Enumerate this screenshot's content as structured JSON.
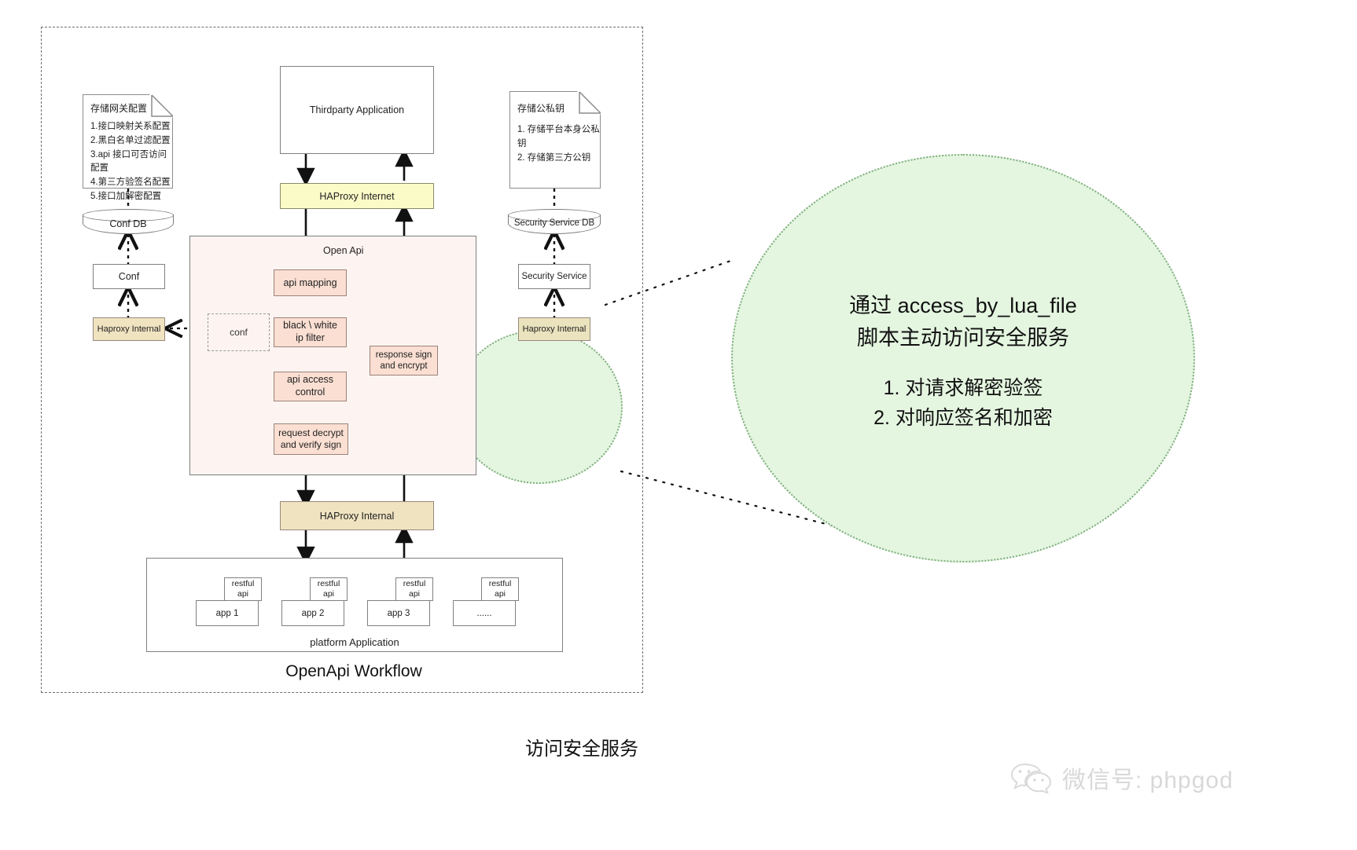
{
  "diagram": {
    "bottom_title": "访问安全服务",
    "workflow_title": "OpenApi Workflow",
    "region_label": "Open Api",
    "platform_label": "platform Application"
  },
  "notes": {
    "gateway_conf": {
      "title": "存储网关配置",
      "lines": [
        "1.接口映射关系配置",
        "2.黑白名单过滤配置",
        "3.api 接口可否访问配置",
        "4.第三方验签名配置",
        "5.接口加解密配置"
      ]
    },
    "keys": {
      "title": "存储公私钥",
      "lines": [
        "1. 存储平台本身公私钥",
        "2. 存储第三方公钥"
      ]
    }
  },
  "nodes": {
    "thirdparty_application": "Thirdparty Application",
    "haproxy_internet": "HAProxy Internet",
    "conf_db": "Conf DB",
    "conf": "Conf",
    "haproxy_internal_left": "Haproxy Internal",
    "security_service_db": "Security Service DB",
    "security_service": "Security Service",
    "haproxy_internal_right": "Haproxy Internal",
    "api_mapping": "api mapping",
    "black_white_ip_filter_l1": "black \\ white",
    "black_white_ip_filter_l2": "ip filter",
    "api_access_control_l1": "api access",
    "api_access_control_l2": "control",
    "request_decrypt_l1": "request decrypt",
    "request_decrypt_l2": "and verify sign",
    "response_sign_l1": "response sign",
    "response_sign_l2": "and encrypt",
    "conf_dashed": "conf",
    "haproxy_internal_bottom": "HAProxy Internal"
  },
  "apps": [
    {
      "api": "restful api",
      "api_l1": "restful",
      "api_l2": "api",
      "name": "app 1"
    },
    {
      "api": "restful api",
      "api_l1": "restful",
      "api_l2": "api",
      "name": "app 2"
    },
    {
      "api": "restful api",
      "api_l1": "restful",
      "api_l2": "api",
      "name": "app 3"
    },
    {
      "api": "restful api",
      "api_l1": "restful",
      "api_l2": "api",
      "name": "......"
    }
  ],
  "callout": {
    "line1": "通过 access_by_lua_file",
    "line2": "脚本主动访问安全服务",
    "item1": "1. 对请求解密验签",
    "item2": "2. 对响应签名和加密"
  },
  "watermark": {
    "text": "微信号: phpgod",
    "icon": "wechat-icon"
  },
  "colors": {
    "pink_fill": "#fadfd2",
    "yellow_fill": "#fbfbc8",
    "tan_fill": "#f0e3c0",
    "region_fill": "#fdf4f2",
    "green_fill": "#e4f5e0",
    "green_stroke": "#7fae7f",
    "stroke": "#808080"
  }
}
